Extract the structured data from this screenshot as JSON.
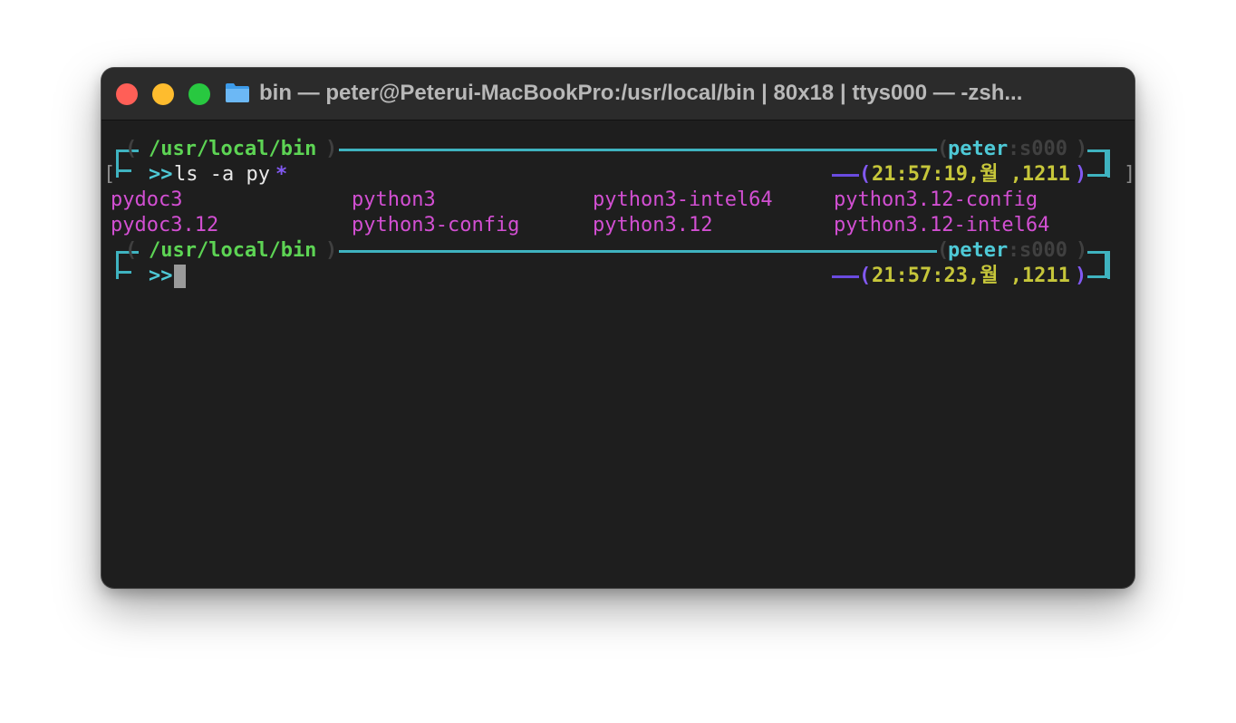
{
  "window": {
    "title": "bin — peter@Peterui-MacBookPro:/usr/local/bin | 80x18 | ttys000 — -zsh..."
  },
  "icons": {
    "folder": "folder-icon",
    "close": "close-icon",
    "minimize": "minimize-icon",
    "maximize": "maximize-icon"
  },
  "colors": {
    "close": "#ff5f57",
    "minimize": "#febc2e",
    "maximize": "#28c840",
    "path": "#5dd454",
    "frame": "#4ec9d6",
    "time": "#c6c63a",
    "listing": "#d24fd2",
    "glob": "#8259f2"
  },
  "prompt1": {
    "path": "/usr/local/bin",
    "user": "peter",
    "tty": "s000",
    "arrow": ">>",
    "command": "ls -a py",
    "glob": "*",
    "time": "21:57:19,월 ,1211"
  },
  "listing": [
    [
      "pydoc3",
      "python3",
      "python3-intel64",
      "python3.12-config"
    ],
    [
      "pydoc3.12",
      "python3-config",
      "python3.12",
      "python3.12-intel64"
    ]
  ],
  "prompt2": {
    "path": "/usr/local/bin",
    "user": "peter",
    "tty": "s000",
    "arrow": ">>",
    "time": "21:57:23,월 ,1211"
  }
}
